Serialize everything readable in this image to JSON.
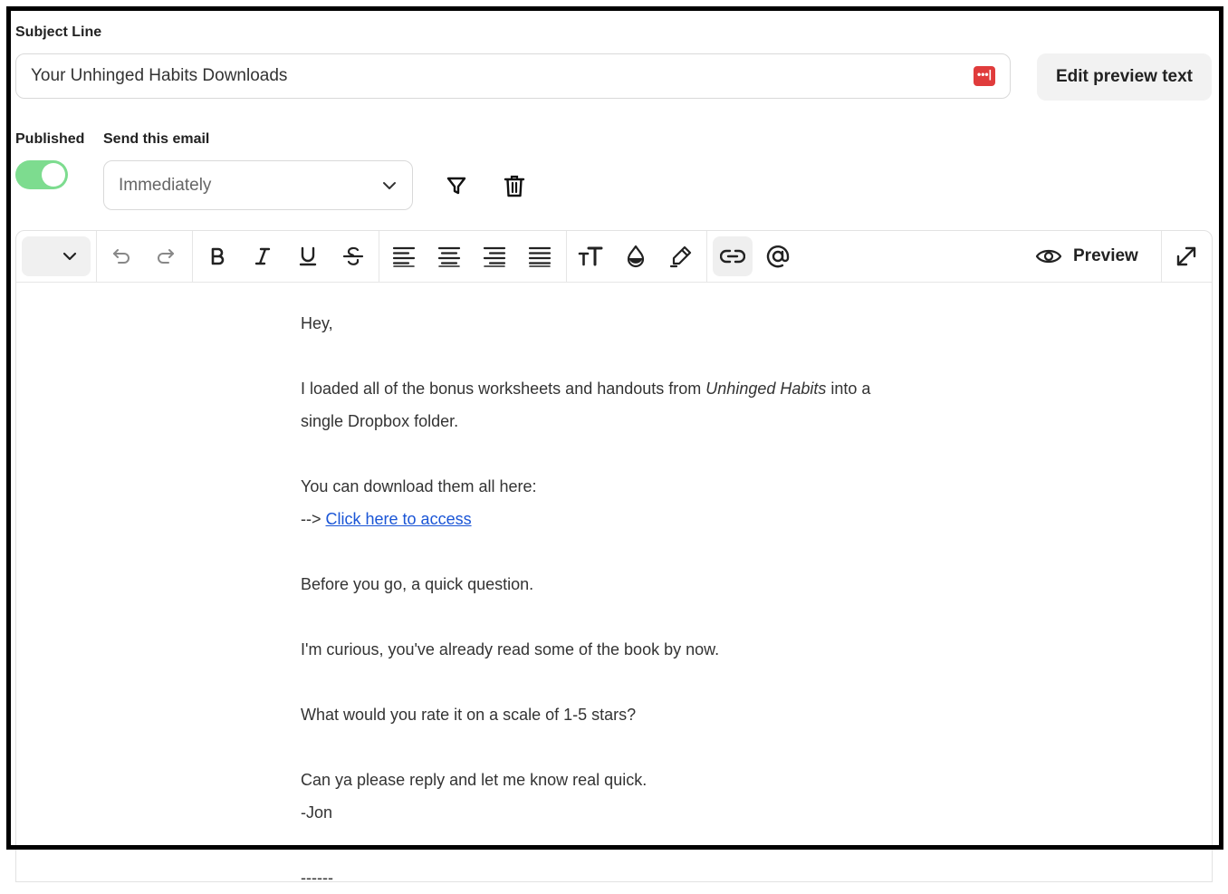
{
  "subject": {
    "label": "Subject Line",
    "value": "Your Unhinged Habits Downloads",
    "merge_icon_glyph": "•••|",
    "merge_icon_color": "#e03c3c"
  },
  "preview_text_button": "Edit preview text",
  "published": {
    "label": "Published",
    "on": true,
    "color": "#7ddc8f"
  },
  "send": {
    "label": "Send this email",
    "selected": "Immediately"
  },
  "actions": {
    "filter_icon": "filter-icon",
    "delete_icon": "trash-icon"
  },
  "toolbar": {
    "style_dropdown_value": "",
    "buttons": [
      "undo",
      "redo",
      "bold",
      "italic",
      "underline",
      "strikethrough",
      "align-left",
      "align-center",
      "align-right",
      "align-justify",
      "text-size",
      "text-color",
      "highlight",
      "link",
      "mention"
    ],
    "preview_label": "Preview",
    "expand_icon": "expand-icon"
  },
  "body": {
    "greeting": "Hey,",
    "p1_before": "I loaded all of the bonus worksheets and handouts from ",
    "p1_italic": "Unhinged Habits",
    "p1_after": " into a",
    "p1_line2": "single Dropbox folder.",
    "p2": "You can download them all here:",
    "arrow": "--> ",
    "link_text": "Click here to access",
    "p3": "Before you go, a quick question.",
    "p4": "I'm curious, you've already read some of the book by now.",
    "p5": "What would you rate it on a scale of 1-5 stars?",
    "p6": "Can ya please reply and let me know real quick.",
    "signature": "-Jon",
    "divider": "------"
  }
}
